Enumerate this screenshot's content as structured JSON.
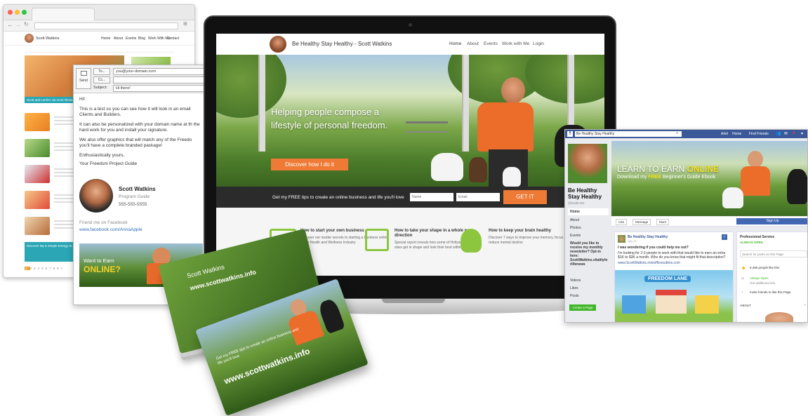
{
  "browser": {
    "site_name": "Scott Watkins",
    "nav": [
      "Home",
      "About",
      "Events",
      "Blog",
      "Work With Me",
      "Contact"
    ],
    "hero_caption": "Scott and Leeher via more Revie",
    "footer_banner": "Discover My 5 Simple Energy St",
    "pagination": [
      "1",
      "2",
      "3",
      "4",
      "5",
      "6",
      "7",
      "8",
      "9",
      "»"
    ]
  },
  "email": {
    "send_label": "Send",
    "to_label": "To...",
    "cc_label": "Cc...",
    "subject_label": "Subject:",
    "to_value": "you@your-domain.com",
    "subject_value": "Hi there!",
    "greeting": "Hi!",
    "p1": "This is a test so you can see how it will look in an email Clients and Builders.",
    "p2": "It can also be personalized with your domain name at th the hard work for you and install your signature.",
    "p3": "We also offer graphics that will match any of the Freedo you'll have a complete branded package!",
    "closing": "Enthusiastically yours,",
    "guide": "Your Freedom Project Guide",
    "sig_name": "Scott Watkins",
    "sig_title": "Program Guide",
    "sig_phone": "555-555-5555",
    "friend_label": "Friend me on Facebook",
    "fb_link": "www.facebook.com/AnnaApple",
    "banner_small": "Want to Earn",
    "banner_big": "ONLINE?"
  },
  "site": {
    "title": "Be Healthy Stay Healthy - Scott Watkins",
    "nav": [
      "Home",
      "About",
      "Events",
      "Work with Me",
      "Login"
    ],
    "headline": "Helping people compose a lifestyle of personal freedom.",
    "cta": "Discover how I do it",
    "optin_text": "Get my FREE tips to create an online business and life you'll love",
    "name_placeholder": "Name",
    "email_placeholder": "Email",
    "optin_button": "GET IT",
    "features": [
      {
        "title": "How to start your own business",
        "text": "Discover our insider secrets to starting a business online in the Health and Wellness Industry"
      },
      {
        "title": "How to take your shape in a whole new direction",
        "text": "Special report reveals how some of Hollywood's biggest stars get in shape and look their best within weeks"
      },
      {
        "title": "How to keep your brain healthy",
        "text": "Discover 7 ways to improve your memory, focus and reduce mental decline"
      }
    ]
  },
  "facebook": {
    "search_value": "Be Healthy Stay Healthy",
    "user": "Ariel",
    "home": "Home",
    "find_friends": "Find Friends",
    "page_name": "Be Healthy Stay Healthy",
    "handle": "@bsd6r160",
    "left_nav": [
      "Home",
      "About",
      "Photos",
      "Events",
      "Would you like to receive my monthly newsletter? Opt-in here: ScottWatkins.vitalityfo rlifenews",
      "Videos",
      "Likes",
      "Posts"
    ],
    "create_page": "Create a Page",
    "cover_line1": "LEARN TO EARN",
    "cover_online": "ONLINE",
    "cover_line2_pre": "Download my ",
    "cover_free": "FREE",
    "cover_line2_post": " Beginner's Guide Ebook",
    "actions": [
      "Like",
      "Message",
      "More"
    ],
    "signup": "Sign Up",
    "post_author": "Be Healthy Stay Healthy",
    "post_date": "July 20 ·",
    "post_q": "I was wondering if you could help me out?",
    "post_body": "I'm looking for 2-3 people to work with that would like to earn an extra $1K to $3K a month. Who do you know that might fit that description?",
    "post_link": "www.ScottWatkins.miniofficeoutlets.com",
    "post_image_text": "FREEDOM LANE",
    "side_category": "Professional Service",
    "side_open": "ALWAYS OPEN",
    "side_search": "Search for posts on this Page",
    "side_likes": "6,465 people like this",
    "side_open2": "Always Open",
    "side_info": "Get additional info",
    "side_invite": "Invite friends to like this Page",
    "side_about": "ABOUT"
  },
  "cards": {
    "name": "Scott Watkins",
    "tagline": "Get my FREE tips to create an online business and life you'll love",
    "url": "www.scottwatkins.info"
  }
}
